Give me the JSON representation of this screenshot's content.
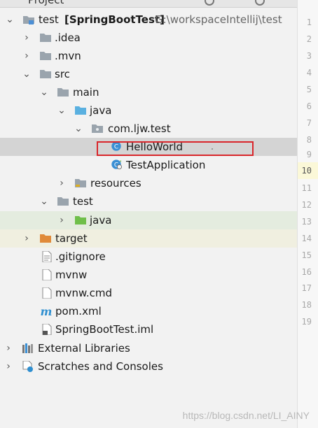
{
  "topbar": {
    "title": "Project"
  },
  "tree": {
    "project_name": "test",
    "module_name": "[SpringBootTest]",
    "project_path": "G:\\workspaceIntellij\\test",
    "idea": ".idea",
    "mvn": ".mvn",
    "src": "src",
    "main": "main",
    "java_main": "java",
    "package": "com.ljw.test",
    "helloworld": "HelloWorld",
    "testapp": "TestApplication",
    "resources": "resources",
    "test": "test",
    "java_test": "java",
    "target": "target",
    "gitignore": ".gitignore",
    "mvnw": "mvnw",
    "mvnw_cmd": "mvnw.cmd",
    "pom": "pom.xml",
    "iml": "SpringBootTest.iml",
    "ext_libs": "External Libraries",
    "scratches": "Scratches and Consoles"
  },
  "gutter": {
    "lines": [
      "1",
      "2",
      "3",
      "4",
      "5",
      "6",
      "7",
      "8",
      "9",
      "10",
      "11",
      "12",
      "13",
      "14",
      "15",
      "16",
      "17",
      "18",
      "19"
    ],
    "current_line": "10"
  },
  "colors": {
    "selection": "#d4d4d4",
    "highlight_box": "#d9262b",
    "test_folder": "#6fbf4a",
    "source_folder": "#5ab0e0",
    "excluded_folder": "#e08a3a",
    "folder": "#9aa4ad"
  },
  "watermark": "https://blog.csdn.net/LI_AINY"
}
